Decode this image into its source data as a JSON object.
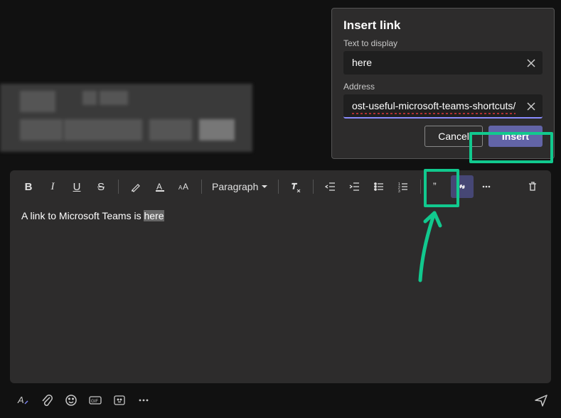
{
  "dialog": {
    "title": "Insert link",
    "text_label": "Text to display",
    "text_value": "here",
    "address_label": "Address",
    "address_value": "ost-useful-microsoft-teams-shortcuts/",
    "cancel_label": "Cancel",
    "insert_label": "Insert"
  },
  "toolbar": {
    "bold": "B",
    "paragraph_label": "Paragraph"
  },
  "editor": {
    "prefix": "A link to Microsoft Teams is ",
    "selected": "here"
  },
  "colors": {
    "accent": "#6264a7",
    "highlight": "#11c98e"
  }
}
